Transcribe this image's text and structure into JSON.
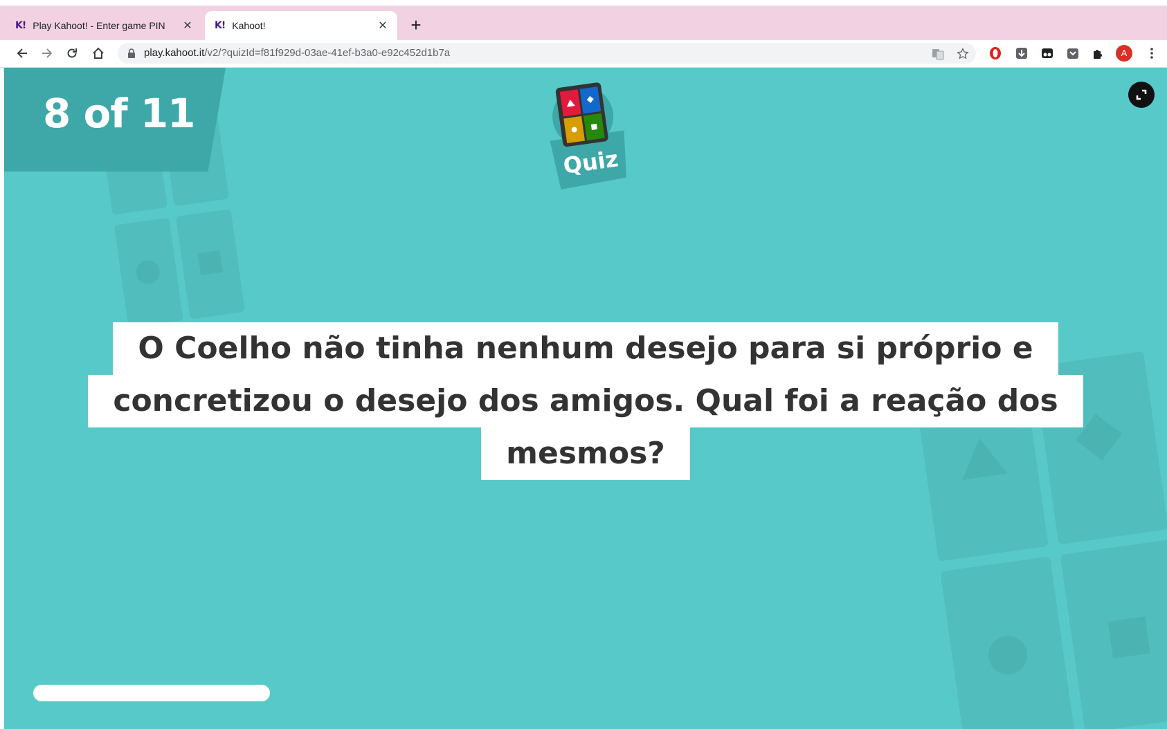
{
  "browser": {
    "tabs": [
      {
        "favicon": "K!",
        "title": "Play Kahoot! - Enter game PIN",
        "close": "✕"
      },
      {
        "favicon": "K!",
        "title": "Kahoot!",
        "close": "✕"
      }
    ],
    "new_tab": "+",
    "url_host": "play.kahoot.it",
    "url_path": "/v2/?quizId=f81f929d-03ae-41ef-b3a0-e92c452d1b7a",
    "profile_initial": "A"
  },
  "game": {
    "counter": "8 of 11",
    "badge_label": "Quiz",
    "question_lines": [
      "O Coelho não tinha nenhum desejo para si próprio e",
      "concretizou o desejo dos amigos. Qual foi a reação dos",
      "mesmos?"
    ],
    "timer_progress": 0.2
  },
  "colors": {
    "background": "#58c9c9",
    "banner": "#3ea8a8",
    "tabstrip": "#f2d2e2",
    "question_text": "#333333"
  }
}
